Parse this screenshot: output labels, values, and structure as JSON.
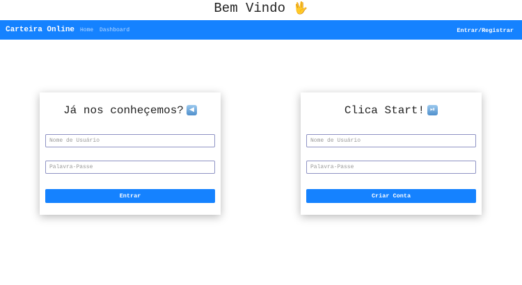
{
  "header": {
    "title": "Bem Vindo",
    "hand_emoji": "🖖"
  },
  "navbar": {
    "brand": "Carteira Online",
    "links": [
      "Home",
      "Dashboard"
    ],
    "auth_link": "Entrar/Registrar",
    "bg_color": "#1582ff"
  },
  "login_card": {
    "title": "Já nos conheçemos?",
    "emoji": "◀",
    "username_placeholder": "Nome de Usuário",
    "password_placeholder": "Palavra-Passe",
    "button_label": "Entrar"
  },
  "register_card": {
    "title": "Clica Start!",
    "emoji": "⏯",
    "username_placeholder": "Nome de Usuário",
    "password_placeholder": "Palavra-Passe",
    "button_label": "Criar Conta"
  }
}
